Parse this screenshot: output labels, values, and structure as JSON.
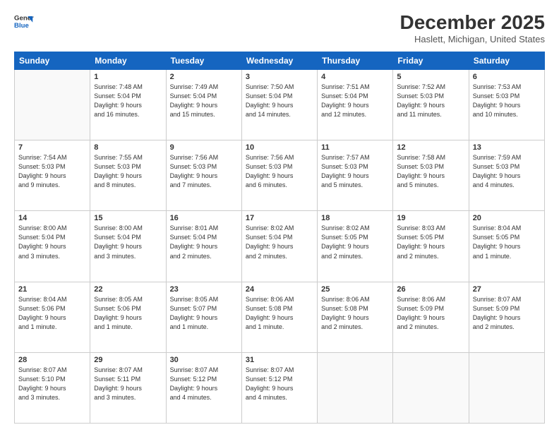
{
  "header": {
    "logo_line1": "General",
    "logo_line2": "Blue",
    "month": "December 2025",
    "location": "Haslett, Michigan, United States"
  },
  "days_of_week": [
    "Sunday",
    "Monday",
    "Tuesday",
    "Wednesday",
    "Thursday",
    "Friday",
    "Saturday"
  ],
  "weeks": [
    [
      {
        "day": "",
        "info": ""
      },
      {
        "day": "1",
        "info": "Sunrise: 7:48 AM\nSunset: 5:04 PM\nDaylight: 9 hours\nand 16 minutes."
      },
      {
        "day": "2",
        "info": "Sunrise: 7:49 AM\nSunset: 5:04 PM\nDaylight: 9 hours\nand 15 minutes."
      },
      {
        "day": "3",
        "info": "Sunrise: 7:50 AM\nSunset: 5:04 PM\nDaylight: 9 hours\nand 14 minutes."
      },
      {
        "day": "4",
        "info": "Sunrise: 7:51 AM\nSunset: 5:04 PM\nDaylight: 9 hours\nand 12 minutes."
      },
      {
        "day": "5",
        "info": "Sunrise: 7:52 AM\nSunset: 5:03 PM\nDaylight: 9 hours\nand 11 minutes."
      },
      {
        "day": "6",
        "info": "Sunrise: 7:53 AM\nSunset: 5:03 PM\nDaylight: 9 hours\nand 10 minutes."
      }
    ],
    [
      {
        "day": "7",
        "info": "Sunrise: 7:54 AM\nSunset: 5:03 PM\nDaylight: 9 hours\nand 9 minutes."
      },
      {
        "day": "8",
        "info": "Sunrise: 7:55 AM\nSunset: 5:03 PM\nDaylight: 9 hours\nand 8 minutes."
      },
      {
        "day": "9",
        "info": "Sunrise: 7:56 AM\nSunset: 5:03 PM\nDaylight: 9 hours\nand 7 minutes."
      },
      {
        "day": "10",
        "info": "Sunrise: 7:56 AM\nSunset: 5:03 PM\nDaylight: 9 hours\nand 6 minutes."
      },
      {
        "day": "11",
        "info": "Sunrise: 7:57 AM\nSunset: 5:03 PM\nDaylight: 9 hours\nand 5 minutes."
      },
      {
        "day": "12",
        "info": "Sunrise: 7:58 AM\nSunset: 5:03 PM\nDaylight: 9 hours\nand 5 minutes."
      },
      {
        "day": "13",
        "info": "Sunrise: 7:59 AM\nSunset: 5:03 PM\nDaylight: 9 hours\nand 4 minutes."
      }
    ],
    [
      {
        "day": "14",
        "info": "Sunrise: 8:00 AM\nSunset: 5:04 PM\nDaylight: 9 hours\nand 3 minutes."
      },
      {
        "day": "15",
        "info": "Sunrise: 8:00 AM\nSunset: 5:04 PM\nDaylight: 9 hours\nand 3 minutes."
      },
      {
        "day": "16",
        "info": "Sunrise: 8:01 AM\nSunset: 5:04 PM\nDaylight: 9 hours\nand 2 minutes."
      },
      {
        "day": "17",
        "info": "Sunrise: 8:02 AM\nSunset: 5:04 PM\nDaylight: 9 hours\nand 2 minutes."
      },
      {
        "day": "18",
        "info": "Sunrise: 8:02 AM\nSunset: 5:05 PM\nDaylight: 9 hours\nand 2 minutes."
      },
      {
        "day": "19",
        "info": "Sunrise: 8:03 AM\nSunset: 5:05 PM\nDaylight: 9 hours\nand 2 minutes."
      },
      {
        "day": "20",
        "info": "Sunrise: 8:04 AM\nSunset: 5:05 PM\nDaylight: 9 hours\nand 1 minute."
      }
    ],
    [
      {
        "day": "21",
        "info": "Sunrise: 8:04 AM\nSunset: 5:06 PM\nDaylight: 9 hours\nand 1 minute."
      },
      {
        "day": "22",
        "info": "Sunrise: 8:05 AM\nSunset: 5:06 PM\nDaylight: 9 hours\nand 1 minute."
      },
      {
        "day": "23",
        "info": "Sunrise: 8:05 AM\nSunset: 5:07 PM\nDaylight: 9 hours\nand 1 minute."
      },
      {
        "day": "24",
        "info": "Sunrise: 8:06 AM\nSunset: 5:08 PM\nDaylight: 9 hours\nand 1 minute."
      },
      {
        "day": "25",
        "info": "Sunrise: 8:06 AM\nSunset: 5:08 PM\nDaylight: 9 hours\nand 2 minutes."
      },
      {
        "day": "26",
        "info": "Sunrise: 8:06 AM\nSunset: 5:09 PM\nDaylight: 9 hours\nand 2 minutes."
      },
      {
        "day": "27",
        "info": "Sunrise: 8:07 AM\nSunset: 5:09 PM\nDaylight: 9 hours\nand 2 minutes."
      }
    ],
    [
      {
        "day": "28",
        "info": "Sunrise: 8:07 AM\nSunset: 5:10 PM\nDaylight: 9 hours\nand 3 minutes."
      },
      {
        "day": "29",
        "info": "Sunrise: 8:07 AM\nSunset: 5:11 PM\nDaylight: 9 hours\nand 3 minutes."
      },
      {
        "day": "30",
        "info": "Sunrise: 8:07 AM\nSunset: 5:12 PM\nDaylight: 9 hours\nand 4 minutes."
      },
      {
        "day": "31",
        "info": "Sunrise: 8:07 AM\nSunset: 5:12 PM\nDaylight: 9 hours\nand 4 minutes."
      },
      {
        "day": "",
        "info": ""
      },
      {
        "day": "",
        "info": ""
      },
      {
        "day": "",
        "info": ""
      }
    ]
  ]
}
